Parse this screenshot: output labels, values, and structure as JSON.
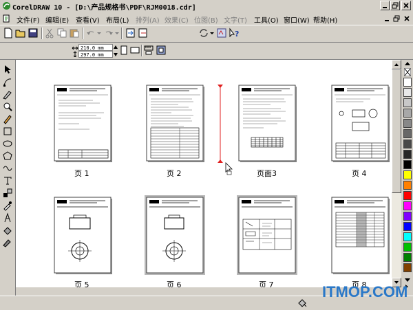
{
  "window": {
    "title": "CorelDRAW 10 - [D:\\产品规格书\\PDF\\RJM0018.cdr]"
  },
  "menu": {
    "items": [
      {
        "label": "文件(F)",
        "enabled": true
      },
      {
        "label": "编辑(E)",
        "enabled": true
      },
      {
        "label": "查看(V)",
        "enabled": true
      },
      {
        "label": "布局(L)",
        "enabled": true
      },
      {
        "label": "排列(A)",
        "enabled": false
      },
      {
        "label": "效果(C)",
        "enabled": false
      },
      {
        "label": "位图(B)",
        "enabled": false
      },
      {
        "label": "文字(T)",
        "enabled": false
      },
      {
        "label": "工具(O)",
        "enabled": true
      },
      {
        "label": "窗口(W)",
        "enabled": true
      },
      {
        "label": "帮助(H)",
        "enabled": true
      }
    ]
  },
  "toolbar": {
    "zoom_value": "19"
  },
  "propertybar": {
    "paper_size": "A4",
    "width": "210.0 mm",
    "height": "297.0 mm"
  },
  "pages": [
    {
      "label": "页 1"
    },
    {
      "label": "页 2"
    },
    {
      "label": "页面3"
    },
    {
      "label": "页 4"
    },
    {
      "label": "页 5"
    },
    {
      "label": "页 6"
    },
    {
      "label": "页 7"
    },
    {
      "label": "页 8"
    }
  ],
  "palette": {
    "colors": [
      "#ffffff",
      "#e8e8e8",
      "#c8c8c8",
      "#a8a8a8",
      "#888888",
      "#686868",
      "#484848",
      "#282828",
      "#000000",
      "#ffff00",
      "#ff8000",
      "#ff0000",
      "#ff00ff",
      "#8000ff",
      "#0000ff",
      "#00ffff",
      "#00c000",
      "#008000",
      "#804000"
    ]
  },
  "watermark": {
    "text": "ITMOP.COM"
  }
}
